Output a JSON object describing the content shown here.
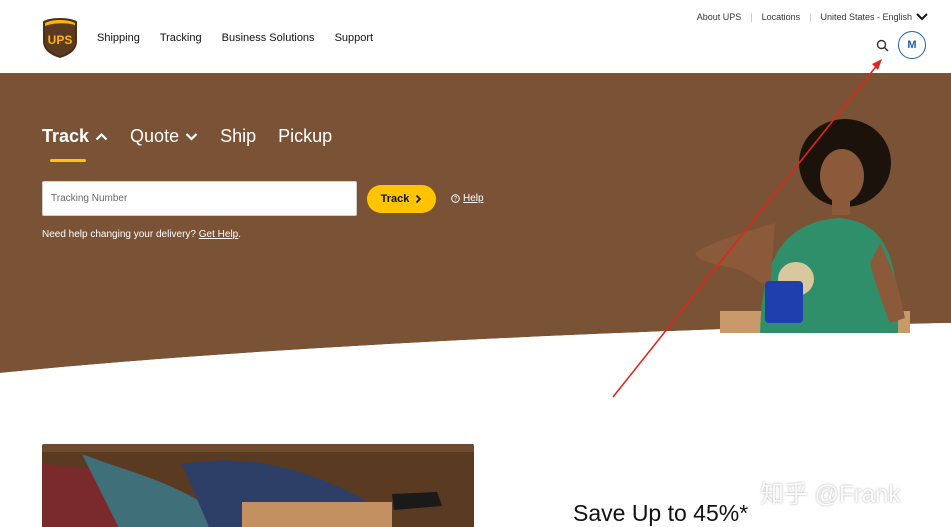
{
  "brand": {
    "logo_text": "UPS"
  },
  "header": {
    "main_nav": [
      "Shipping",
      "Tracking",
      "Business Solutions",
      "Support"
    ],
    "utility": {
      "about": "About UPS",
      "locations": "Locations",
      "language": "United States - English"
    },
    "avatar_initial": "M"
  },
  "hero": {
    "tabs": [
      "Track",
      "Quote",
      "Ship",
      "Pickup"
    ],
    "tracking_placeholder": "Tracking Number",
    "track_button": "Track",
    "help_link": "Help",
    "change_text": "Need help changing your delivery?",
    "change_link": "Get Help",
    "change_suffix": "."
  },
  "promo": {
    "title": "Save Up to 45%*"
  },
  "watermark": "知乎 @Frank",
  "colors": {
    "brown": "#7a5236",
    "gold": "#ffc400",
    "avatar_blue": "#1e5fa8",
    "arrow_red": "#e0271f"
  }
}
